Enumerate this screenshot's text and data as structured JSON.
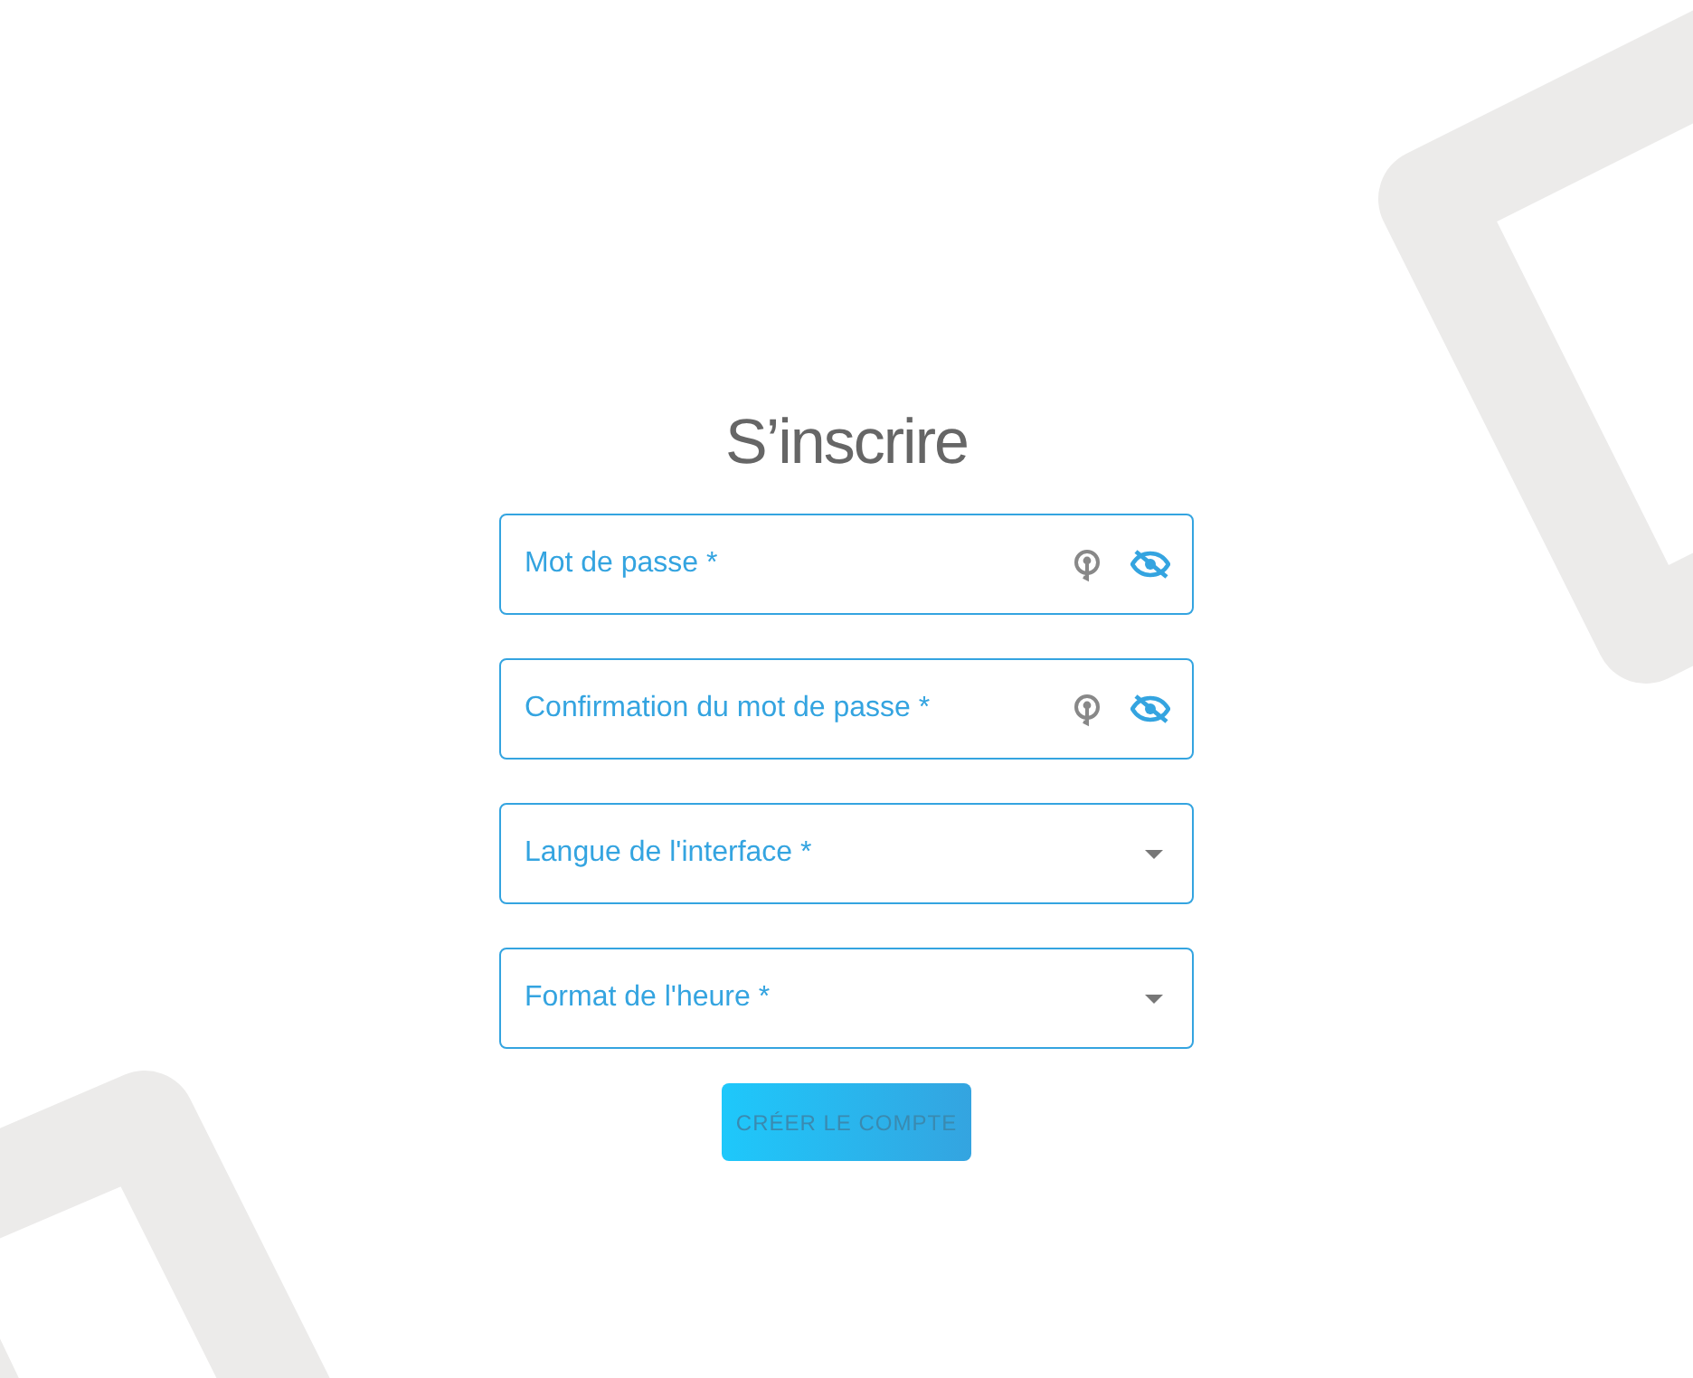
{
  "title": "S’inscrire",
  "fields": [
    {
      "kind": "password",
      "placeholder": "Mot de passe *"
    },
    {
      "kind": "password",
      "placeholder": "Confirmation du mot de passe *"
    },
    {
      "kind": "select",
      "placeholder": "Langue de l'interface *"
    },
    {
      "kind": "select",
      "placeholder": "Format de l'heure *"
    }
  ],
  "submit": {
    "label": "CRÉER LE COMPTE",
    "disabled": true
  }
}
